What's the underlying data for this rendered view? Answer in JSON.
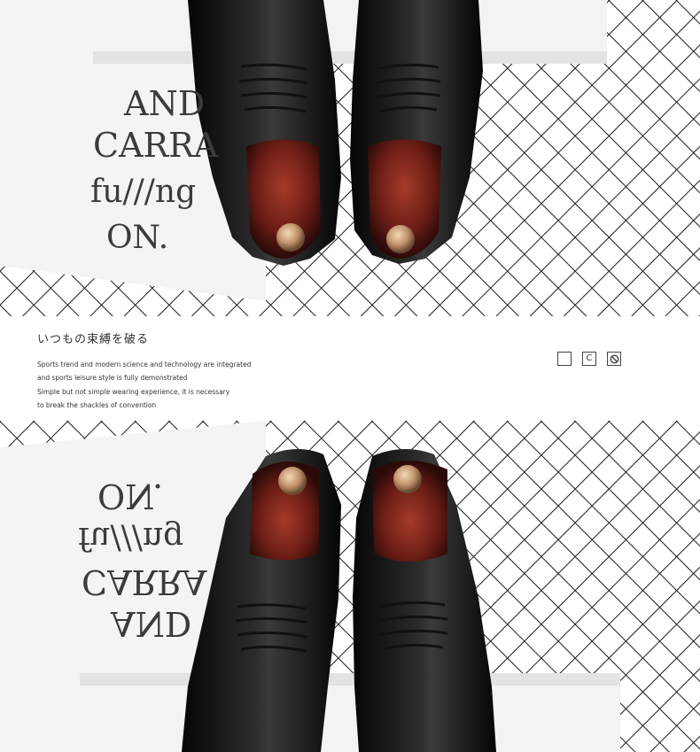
{
  "top_card": {
    "line1": "AND",
    "line2": "CARRA",
    "line3": "fu///ng",
    "line4": "ON."
  },
  "band": {
    "heading": "いつもの束縛を破る",
    "copy_lines": [
      "Sports trend and modern science and technology are integrated",
      "and sports leisure style is fully demonstrated",
      "Simple but not simple wearing experience, it is necessary",
      "to break the shackles of convention"
    ],
    "icons": [
      {
        "name": "square-icon",
        "glyph": ""
      },
      {
        "name": "c-icon",
        "glyph": "C"
      },
      {
        "name": "prohibit-icon",
        "glyph": ""
      }
    ]
  },
  "bottom_card": {
    "line1": "ON.",
    "line2": "fu///ng",
    "line3": "CARRA",
    "line4": "AND"
  }
}
